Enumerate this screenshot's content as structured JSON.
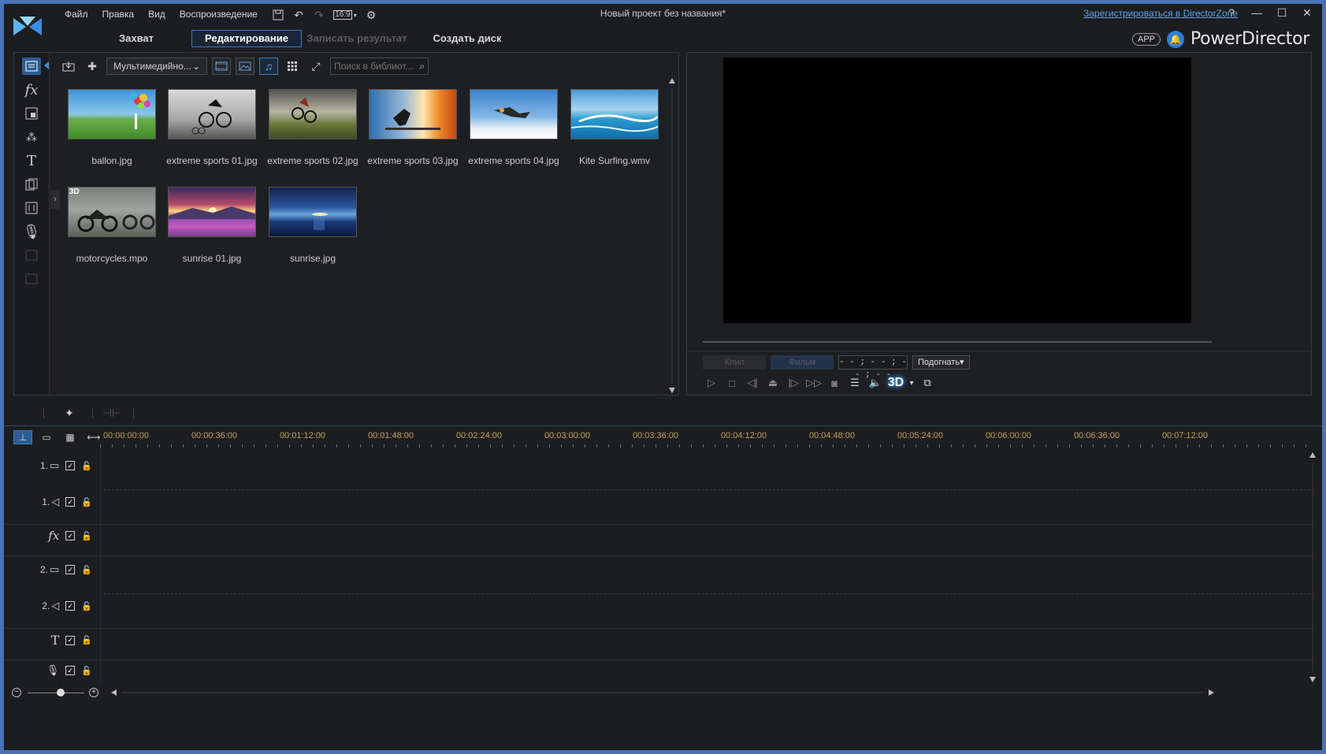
{
  "window": {
    "title": "Новый проект без названия*",
    "register_link": "Зарегистрироваться в DirectorZone",
    "help": "?",
    "minimize": "—",
    "maximize": "☐",
    "close": "✕"
  },
  "menu": [
    "Файл",
    "Правка",
    "Вид",
    "Воспроизведение"
  ],
  "toolbar": {
    "aspect_ratio": "16:9"
  },
  "module_tabs": [
    {
      "label": "Захват",
      "state": "normal"
    },
    {
      "label": "Редактирование",
      "state": "active"
    },
    {
      "label": "Записать результат",
      "state": "disabled"
    },
    {
      "label": "Создать диск",
      "state": "normal"
    }
  ],
  "brand": {
    "app_badge": "APP",
    "name": "PowerDirector"
  },
  "library": {
    "filter_dropdown": "Мультимедийно...",
    "search_placeholder": "Поиск в библиот...",
    "items": [
      {
        "name": "ballon.jpg",
        "badge": ""
      },
      {
        "name": "extreme sports 01.jpg",
        "badge": ""
      },
      {
        "name": "extreme sports 02.jpg",
        "badge": ""
      },
      {
        "name": "extreme sports 03.jpg",
        "badge": ""
      },
      {
        "name": "extreme sports 04.jpg",
        "badge": ""
      },
      {
        "name": "Kite Surfing.wmv",
        "badge": ""
      },
      {
        "name": "motorcycles.mpo",
        "badge": "3D"
      },
      {
        "name": "sunrise 01.jpg",
        "badge": ""
      },
      {
        "name": "sunrise.jpg",
        "badge": ""
      }
    ]
  },
  "preview": {
    "clip_btn": "Клип",
    "movie_btn": "Фильм",
    "timecode": "- - ; - - ; - - ; - -",
    "fit_btn": "Подогнать▾",
    "stereo_label": "3D"
  },
  "timeline": {
    "ruler": [
      "00:00:00:00",
      "00:00:36:00",
      "00:01:12:00",
      "00:01:48:00",
      "00:02:24:00",
      "00:03:00:00",
      "00:03:36:00",
      "00:04:12:00",
      "00:04:48:00",
      "00:05:24:00",
      "00:06:00:00",
      "00:06:36:00",
      "00:07:12:00"
    ],
    "tracks": [
      {
        "num": "1.",
        "icon": "video-track-icon"
      },
      {
        "num": "1.",
        "icon": "audio-track-icon"
      },
      {
        "num": "",
        "icon": "fx-track-icon"
      },
      {
        "num": "2.",
        "icon": "video-track-icon"
      },
      {
        "num": "2.",
        "icon": "audio-track-icon"
      },
      {
        "num": "",
        "icon": "title-track-icon"
      },
      {
        "num": "",
        "icon": "voice-track-icon"
      }
    ]
  },
  "colors": {
    "accent": "#3a7cc3",
    "ruler_text": "#c5a25a",
    "background": "#1c1d20",
    "frame": "#4a72b8"
  }
}
